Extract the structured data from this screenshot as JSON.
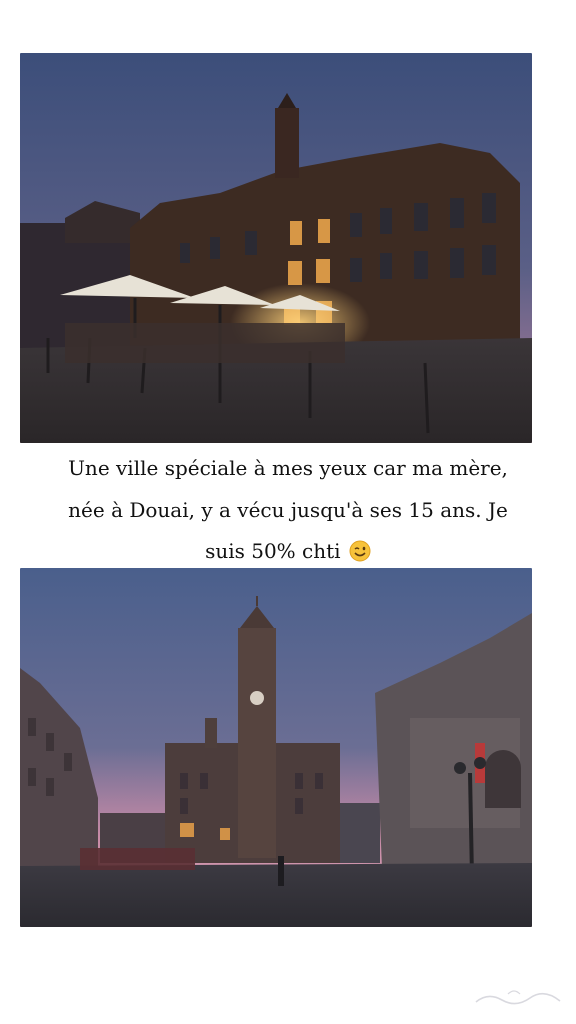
{
  "caption": {
    "line1": "Une ville spéciale à mes yeux car ma mère,",
    "line2": "née à Douai, y a vécu jusqu'à ses 15 ans. Je",
    "line3": "suis 50% chti",
    "emoji": "winking-face"
  },
  "photos": [
    {
      "subject": "Vieille Bourse at dusk with terrace umbrellas"
    },
    {
      "subject": "Place du Théâtre with belfry tower at dusk"
    }
  ],
  "colors": {
    "sky_top": "#3a4a6e",
    "sky_dusk": "#c98aa0",
    "building": "#3a2a22",
    "pavement": "#2e2a2e",
    "warm_light": "#f2b35a"
  }
}
